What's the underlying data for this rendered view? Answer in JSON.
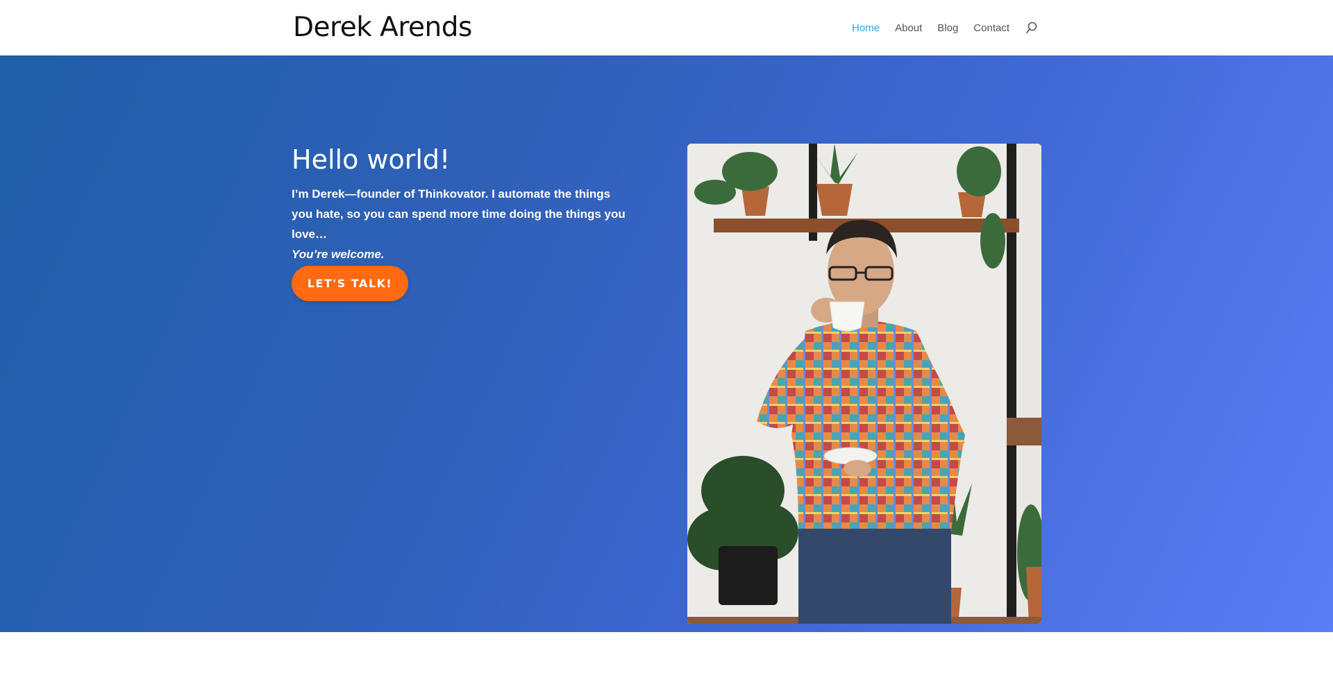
{
  "site": {
    "logo_text": "Derek Arends"
  },
  "nav": {
    "items": [
      {
        "label": "Home",
        "active": true
      },
      {
        "label": "About"
      },
      {
        "label": "Blog"
      },
      {
        "label": "Contact"
      }
    ],
    "search_icon": "search-icon"
  },
  "hero": {
    "title": "Hello world!",
    "body": "I’m Derek—founder of Thinkovator. I automate the things you hate, so you can spend more time doing the things you love…",
    "tagline": "You’re welcome.",
    "cta_label": "LET'S TALK!",
    "image_icon": "portrait-photo"
  },
  "colors": {
    "accent": "#2ea3f2",
    "cta": "#ff6a12",
    "gradient_start": "#1f5ea8",
    "gradient_end": "#5b7df6"
  }
}
